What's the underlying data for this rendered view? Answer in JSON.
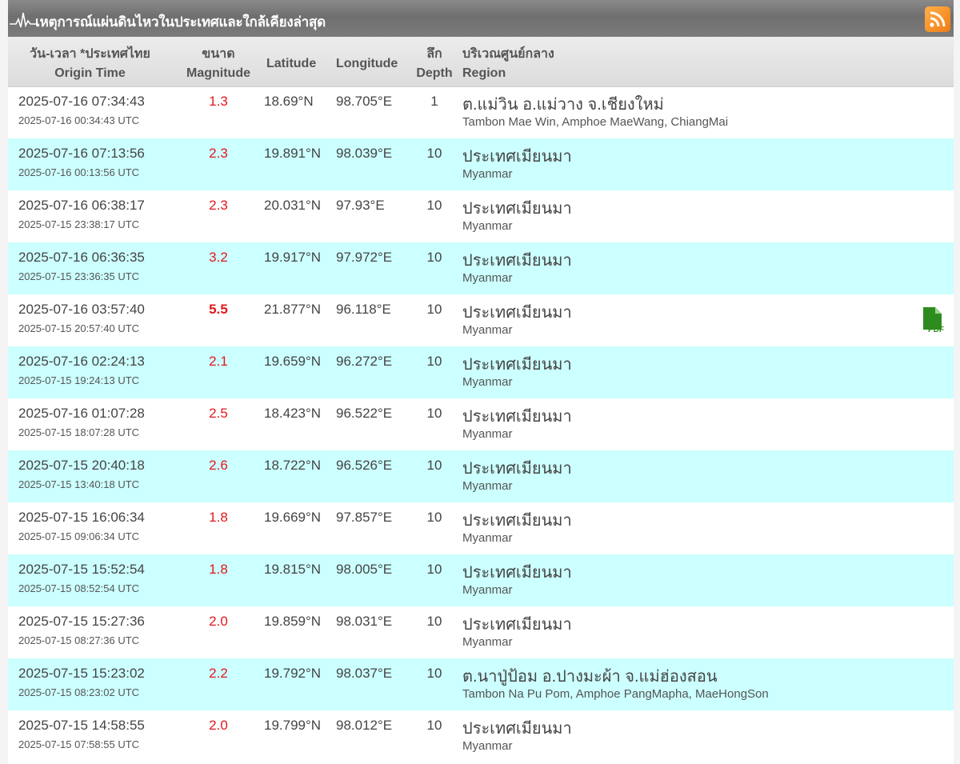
{
  "title": "เหตุการณ์แผ่นดินไหวในประเทศและใกล้เคียงล่าสุด",
  "icons": {
    "pulse": "seismograph-pulse-icon",
    "rss": "rss-feed-icon",
    "pdf": "pdf-report-icon"
  },
  "colors": {
    "title_bg": "#7a7a7a",
    "alt_row": "#ccffff",
    "magnitude": "#e3171c",
    "rss": "#f58220",
    "pdf": "#2e8b1f"
  },
  "columns": {
    "time_th": "วัน-เวลา *ประเทศไทย",
    "time_en": "Origin Time",
    "mag_th": "ขนาด",
    "mag_en": "Magnitude",
    "lat": "Latitude",
    "lon": "Longitude",
    "depth_th": "ลึก",
    "depth_en": "Depth",
    "region_th": "บริเวณศูนย์กลาง",
    "region_en": "Region"
  },
  "rows": [
    {
      "time": "2025-07-16 07:34:43",
      "utc": "2025-07-16 00:34:43 UTC",
      "mag": "1.3",
      "lat": "18.69°N",
      "lon": "98.705°E",
      "depth": "1",
      "region_th": "ต.แม่วิน อ.แม่วาง จ.เชียงใหม่",
      "region_en": "Tambon Mae Win, Amphoe MaeWang, ChiangMai",
      "pdf": false
    },
    {
      "time": "2025-07-16 07:13:56",
      "utc": "2025-07-16 00:13:56 UTC",
      "mag": "2.3",
      "lat": "19.891°N",
      "lon": "98.039°E",
      "depth": "10",
      "region_th": "ประเทศเมียนมา",
      "region_en": "Myanmar",
      "pdf": false
    },
    {
      "time": "2025-07-16 06:38:17",
      "utc": "2025-07-15 23:38:17 UTC",
      "mag": "2.3",
      "lat": "20.031°N",
      "lon": "97.93°E",
      "depth": "10",
      "region_th": "ประเทศเมียนมา",
      "region_en": "Myanmar",
      "pdf": false
    },
    {
      "time": "2025-07-16 06:36:35",
      "utc": "2025-07-15 23:36:35 UTC",
      "mag": "3.2",
      "lat": "19.917°N",
      "lon": "97.972°E",
      "depth": "10",
      "region_th": "ประเทศเมียนมา",
      "region_en": "Myanmar",
      "pdf": false
    },
    {
      "time": "2025-07-16 03:57:40",
      "utc": "2025-07-15 20:57:40 UTC",
      "mag": "5.5",
      "lat": "21.877°N",
      "lon": "96.118°E",
      "depth": "10",
      "region_th": "ประเทศเมียนมา",
      "region_en": "Myanmar",
      "pdf": true
    },
    {
      "time": "2025-07-16 02:24:13",
      "utc": "2025-07-15 19:24:13 UTC",
      "mag": "2.1",
      "lat": "19.659°N",
      "lon": "96.272°E",
      "depth": "10",
      "region_th": "ประเทศเมียนมา",
      "region_en": "Myanmar",
      "pdf": false
    },
    {
      "time": "2025-07-16 01:07:28",
      "utc": "2025-07-15 18:07:28 UTC",
      "mag": "2.5",
      "lat": "18.423°N",
      "lon": "96.522°E",
      "depth": "10",
      "region_th": "ประเทศเมียนมา",
      "region_en": "Myanmar",
      "pdf": false
    },
    {
      "time": "2025-07-15 20:40:18",
      "utc": "2025-07-15 13:40:18 UTC",
      "mag": "2.6",
      "lat": "18.722°N",
      "lon": "96.526°E",
      "depth": "10",
      "region_th": "ประเทศเมียนมา",
      "region_en": "Myanmar",
      "pdf": false
    },
    {
      "time": "2025-07-15 16:06:34",
      "utc": "2025-07-15 09:06:34 UTC",
      "mag": "1.8",
      "lat": "19.669°N",
      "lon": "97.857°E",
      "depth": "10",
      "region_th": "ประเทศเมียนมา",
      "region_en": "Myanmar",
      "pdf": false
    },
    {
      "time": "2025-07-15 15:52:54",
      "utc": "2025-07-15 08:52:54 UTC",
      "mag": "1.8",
      "lat": "19.815°N",
      "lon": "98.005°E",
      "depth": "10",
      "region_th": "ประเทศเมียนมา",
      "region_en": "Myanmar",
      "pdf": false
    },
    {
      "time": "2025-07-15 15:27:36",
      "utc": "2025-07-15 08:27:36 UTC",
      "mag": "2.0",
      "lat": "19.859°N",
      "lon": "98.031°E",
      "depth": "10",
      "region_th": "ประเทศเมียนมา",
      "region_en": "Myanmar",
      "pdf": false
    },
    {
      "time": "2025-07-15 15:23:02",
      "utc": "2025-07-15 08:23:02 UTC",
      "mag": "2.2",
      "lat": "19.792°N",
      "lon": "98.037°E",
      "depth": "10",
      "region_th": "ต.นาปู่ป้อม อ.ปางมะผ้า จ.แม่ฮ่องสอน",
      "region_en": "Tambon Na Pu Pom, Amphoe PangMapha, MaeHongSon",
      "pdf": false
    },
    {
      "time": "2025-07-15 14:58:55",
      "utc": "2025-07-15 07:58:55 UTC",
      "mag": "2.0",
      "lat": "19.799°N",
      "lon": "98.012°E",
      "depth": "10",
      "region_th": "ประเทศเมียนมา",
      "region_en": "Myanmar",
      "pdf": false
    }
  ]
}
